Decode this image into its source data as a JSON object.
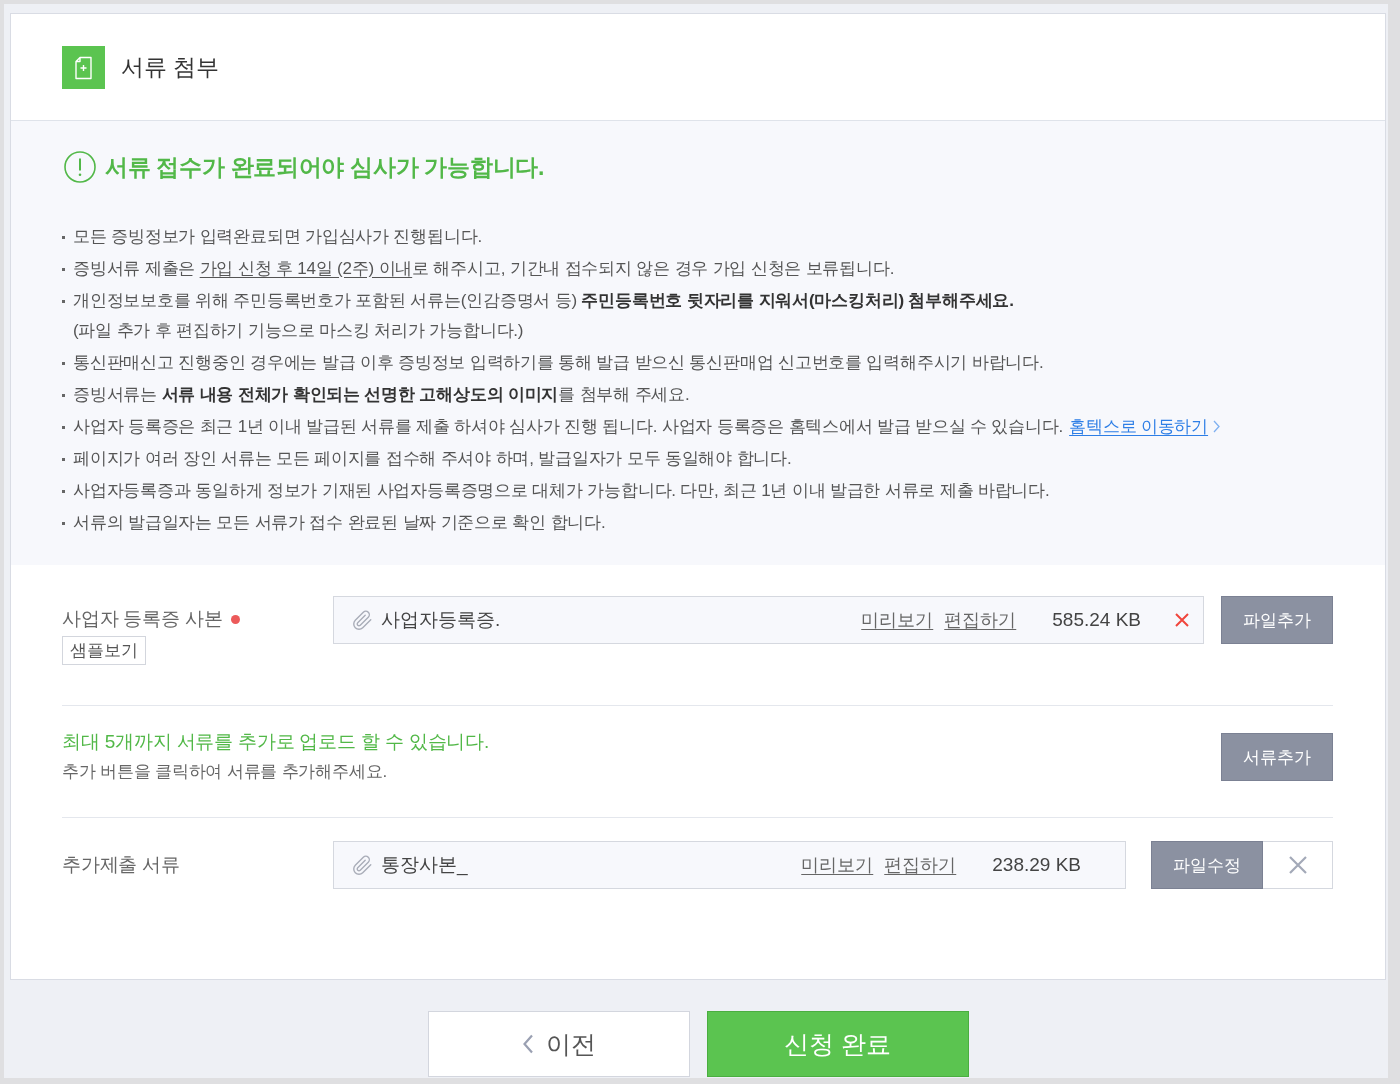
{
  "header": {
    "title": "서류 첨부"
  },
  "notice": {
    "heading": "서류 접수가 완료되어야 심사가 가능합니다.",
    "items": [
      {
        "parts": [
          {
            "text": "모든 증빙정보가 입력완료되면 가입심사가 진행됩니다.",
            "underline": false
          }
        ]
      },
      {
        "parts": [
          {
            "text": "증빙서류 제출은 ",
            "underline": false
          },
          {
            "text": "가입 신청 후 14일 (2주) 이내",
            "underline": true
          },
          {
            "text": "로 해주시고, 기간내 접수되지 않은 경우 가입 신청은 보류됩니다.",
            "underline": false
          }
        ]
      },
      {
        "parts": [
          {
            "text": "개인정보보호를 위해 주민등록번호가 포함된 서류는(인감증명서 등) **주민등록번호 뒷자리를 지워서(마스킹처리) 첨부해주세요.**",
            "underline": false
          }
        ],
        "note": "(파일 추가 후 편집하기 기능으로 마스킹 처리가 가능합니다.)"
      },
      {
        "parts": [
          {
            "text": "통신판매신고 진행중인 경우에는 발급 이후 증빙정보 입력하기를 통해 발급 받으신 통신판매업 신고번호를 입력해주시기 바랍니다.",
            "underline": false
          }
        ]
      },
      {
        "parts": [
          {
            "text": "증빙서류는 **서류 내용 전체가 확인되는 선명한 고해상도의 이미지**를 첨부해 주세요.",
            "underline": false
          }
        ]
      },
      {
        "parts": [
          {
            "text": "사업자 등록증은 최근 1년 이내 발급된 서류를 제출 하셔야 심사가 진행 됩니다. 사업자 등록증은 홈텍스에서 발급 받으실 수 있습니다.",
            "underline": false
          }
        ],
        "link": "홈텍스로 이동하기"
      },
      {
        "parts": [
          {
            "text": "페이지가 여러 장인 서류는 모든 페이지를 접수해 주셔야 하며, 발급일자가 모두 동일해야 합니다.",
            "underline": false
          }
        ]
      },
      {
        "parts": [
          {
            "text": "사업자등록증과 동일하게 정보가 기재된 사업자등록증명으로 대체가 가능합니다. 다만, 최근 1년 이내 발급한 서류로 제출 바랍니다.",
            "underline": false
          }
        ]
      },
      {
        "parts": [
          {
            "text": "서류의 발급일자는 모든 서류가 접수 완료된 날짜 기준으로 확인 합니다.",
            "underline": false
          }
        ]
      }
    ]
  },
  "business_registration": {
    "label": "사업자 등록증 사본",
    "required": true,
    "sample_button": "샘플보기",
    "file": {
      "name": "사업자등록증.",
      "preview": "미리보기",
      "edit": "편집하기",
      "size": "585.24 KB"
    },
    "button": "파일추가"
  },
  "add_documents": {
    "message": "최대 5개까지 서류를 추가로 업로드 할 수 있습니다.",
    "hint": "추가 버튼을 클릭하여 서류를 추가해주세요.",
    "button": "서류추가"
  },
  "additional_document": {
    "label": "추가제출 서류",
    "file": {
      "name": "통장사본_",
      "preview": "미리보기",
      "edit": "편집하기",
      "size": "238.29 KB"
    },
    "button": "파일수정"
  },
  "footer": {
    "back_button": "이전",
    "submit_button": "신청 완료"
  }
}
